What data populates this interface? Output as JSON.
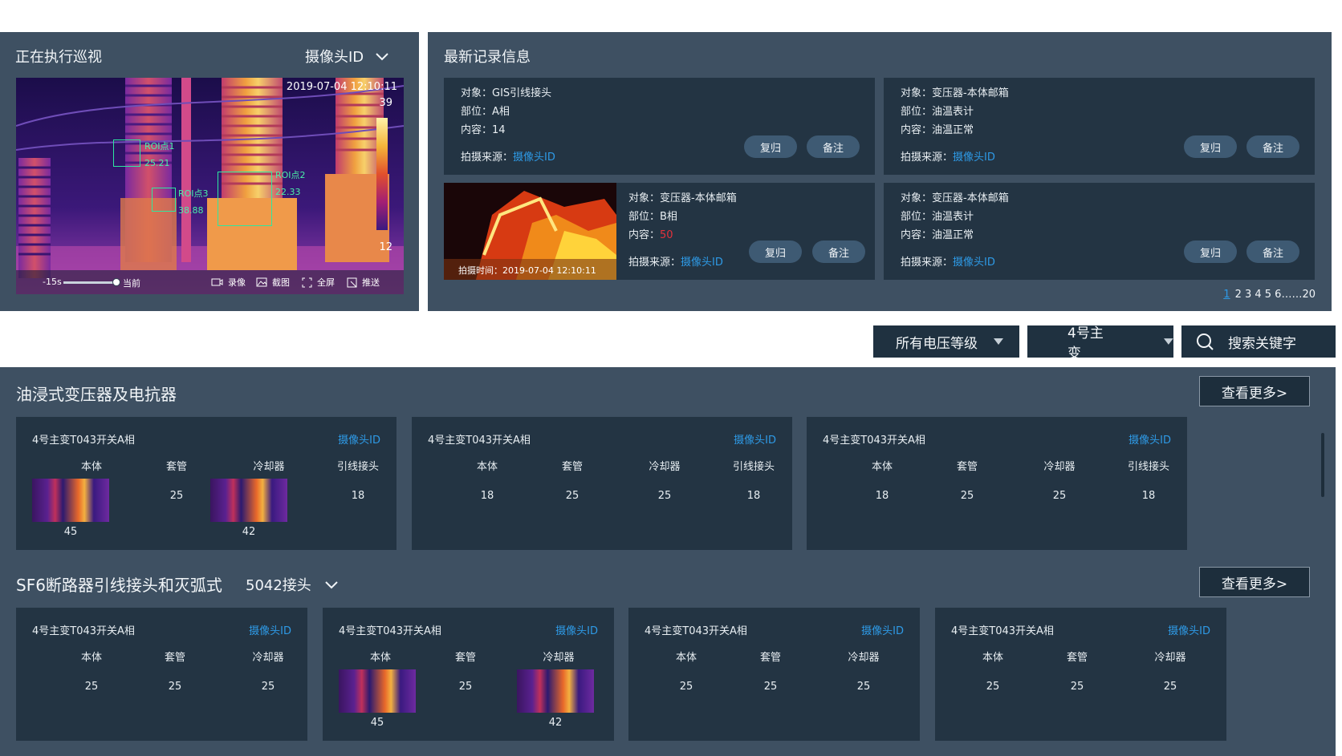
{
  "patrol": {
    "title": "正在执行巡视",
    "camera_select": "摄像头ID",
    "timestamp": "2019-07-04 12:10:11",
    "scale_max": "39",
    "scale_min": "12",
    "rois": [
      {
        "label": "ROI点1",
        "value": "25.21"
      },
      {
        "label": "ROI点2",
        "value": "22.33"
      },
      {
        "label": "ROI点3",
        "value": "38.88"
      }
    ],
    "timeline_start": "-15s",
    "timeline_now": "当前",
    "timeline_position": 1.0,
    "controls": [
      "录像",
      "截图",
      "全屏",
      "推送"
    ]
  },
  "records": {
    "title": "最新记录信息",
    "items": [
      {
        "object": "对象：GIS引线接头",
        "part": "部位：A相",
        "content_label": "内容：",
        "content_value": "14",
        "source_label": "拍摄来源：",
        "source_value": "摄像头ID",
        "btn1": "复归",
        "btn2": "备注"
      },
      {
        "object": "对象：变压器-本体邮箱",
        "part": "部位：油温表计",
        "content_label": "内容：",
        "content_value": "油温正常",
        "source_label": "拍摄来源：",
        "source_value": "摄像头ID",
        "btn1": "复归",
        "btn2": "备注"
      },
      {
        "object": "对象：变压器-本体邮箱",
        "part": "部位：B相",
        "content_label": "内容：",
        "content_value": "50",
        "source_label": "拍摄来源：",
        "source_value": "摄像头ID",
        "btn1": "复归",
        "btn2": "备注",
        "photo_time": "拍摄时间：2019-07-04 12:10:11"
      },
      {
        "object": "对象：变压器-本体邮箱",
        "part": "部位：油温表计",
        "content_label": "内容：",
        "content_value": "油温正常",
        "source_label": "拍摄来源：",
        "source_value": "摄像头ID",
        "btn1": "复归",
        "btn2": "备注"
      }
    ],
    "pagination": {
      "current": "1",
      "pages": "2 3 4 5 6……20"
    }
  },
  "filters": {
    "voltage": "所有电压等级",
    "transformer": "4号主变",
    "search": "搜索关键字"
  },
  "section1": {
    "title": "油浸式变压器及电抗器",
    "more": "查看更多>",
    "cards": [
      {
        "name": "4号主变T043开关A相",
        "cam": "摄像头ID",
        "cols": [
          "本体",
          "套管",
          "冷却器",
          "引线接头"
        ],
        "vals": [
          "",
          "25",
          "",
          "18"
        ],
        "thumb_vals": [
          "45",
          "",
          "42",
          ""
        ]
      },
      {
        "name": "4号主变T043开关A相",
        "cam": "摄像头ID",
        "cols": [
          "本体",
          "套管",
          "冷却器",
          "引线接头"
        ],
        "vals": [
          "18",
          "25",
          "25",
          "18"
        ]
      },
      {
        "name": "4号主变T043开关A相",
        "cam": "摄像头ID",
        "cols": [
          "本体",
          "套管",
          "冷却器",
          "引线接头"
        ],
        "vals": [
          "18",
          "25",
          "25",
          "18"
        ]
      }
    ]
  },
  "section2": {
    "title": "SF6断路器引线接头和灭弧式",
    "selector": "5042接头",
    "more": "查看更多>",
    "cards": [
      {
        "name": "4号主变T043开关A相",
        "cam": "摄像头ID",
        "cols": [
          "本体",
          "套管",
          "冷却器"
        ],
        "vals": [
          "25",
          "25",
          "25"
        ]
      },
      {
        "name": "4号主变T043开关A相",
        "cam": "摄像头ID",
        "cols": [
          "本体",
          "套管",
          "冷却器"
        ],
        "vals": [
          "",
          "25",
          ""
        ],
        "thumb_vals": [
          "45",
          "",
          "42"
        ]
      },
      {
        "name": "4号主变T043开关A相",
        "cam": "摄像头ID",
        "cols": [
          "本体",
          "套管",
          "冷却器"
        ],
        "vals": [
          "25",
          "25",
          "25"
        ]
      },
      {
        "name": "4号主变T043开关A相",
        "cam": "摄像头ID",
        "cols": [
          "本体",
          "套管",
          "冷却器"
        ],
        "vals": [
          "25",
          "25",
          "25"
        ]
      }
    ]
  }
}
